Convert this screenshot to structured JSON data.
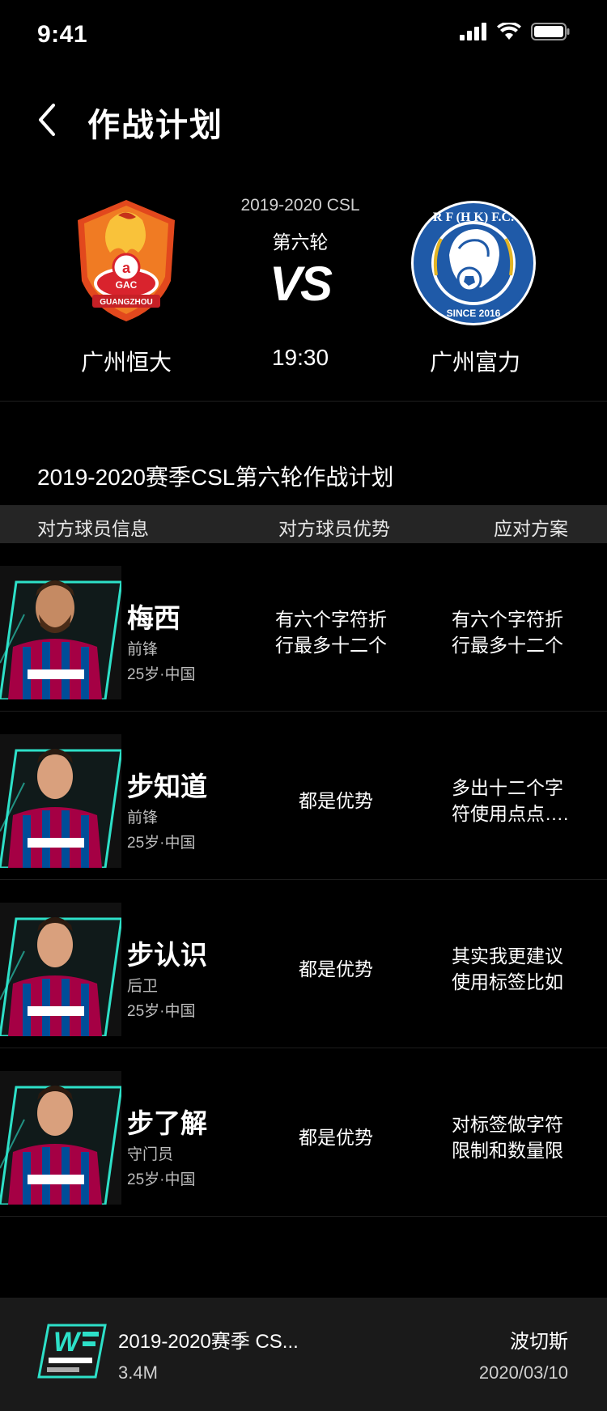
{
  "status": {
    "time": "9:41"
  },
  "nav": {
    "title": "作战计划"
  },
  "match": {
    "season": "2019-2020 CSL",
    "round": "第六轮",
    "vs": "VS",
    "time": "19:30",
    "home": {
      "name": "广州恒大",
      "logo_text": "GUANGZHOU",
      "logo_badge": "GAC"
    },
    "away": {
      "name": "广州富力",
      "logo_text_top": "R F (H K) F.C.",
      "logo_text_bottom": "SINCE 2016"
    }
  },
  "plan": {
    "title": "2019-2020赛季CSL第六轮作战计划",
    "headers": [
      "对方球员信息",
      "对方球员优势",
      "应对方案"
    ],
    "rows": [
      {
        "name": "梅西",
        "position": "前锋",
        "info": "25岁·中国",
        "advantage": "有六个字符折行最多十二个",
        "countermeasure": "有六个字符折行最多十二个"
      },
      {
        "name": "步知道",
        "position": "前锋",
        "info": "25岁·中国",
        "advantage": "都是优势",
        "countermeasure": "多出十二个字符使用点点…."
      },
      {
        "name": "步认识",
        "position": "后卫",
        "info": "25岁·中国",
        "advantage": "都是优势",
        "countermeasure": "其实我更建议使用标签比如"
      },
      {
        "name": "步了解",
        "position": "守门员",
        "info": "25岁·中国",
        "advantage": "都是优势",
        "countermeasure": "对标签做字符限制和数量限"
      }
    ]
  },
  "file": {
    "name": "2019-2020赛季 CS...",
    "size": "3.4M",
    "author": "波切斯",
    "date": "2020/03/10"
  },
  "colors": {
    "accent": "#2de0c8",
    "background": "#000000",
    "bar": "#1a1a1a"
  }
}
